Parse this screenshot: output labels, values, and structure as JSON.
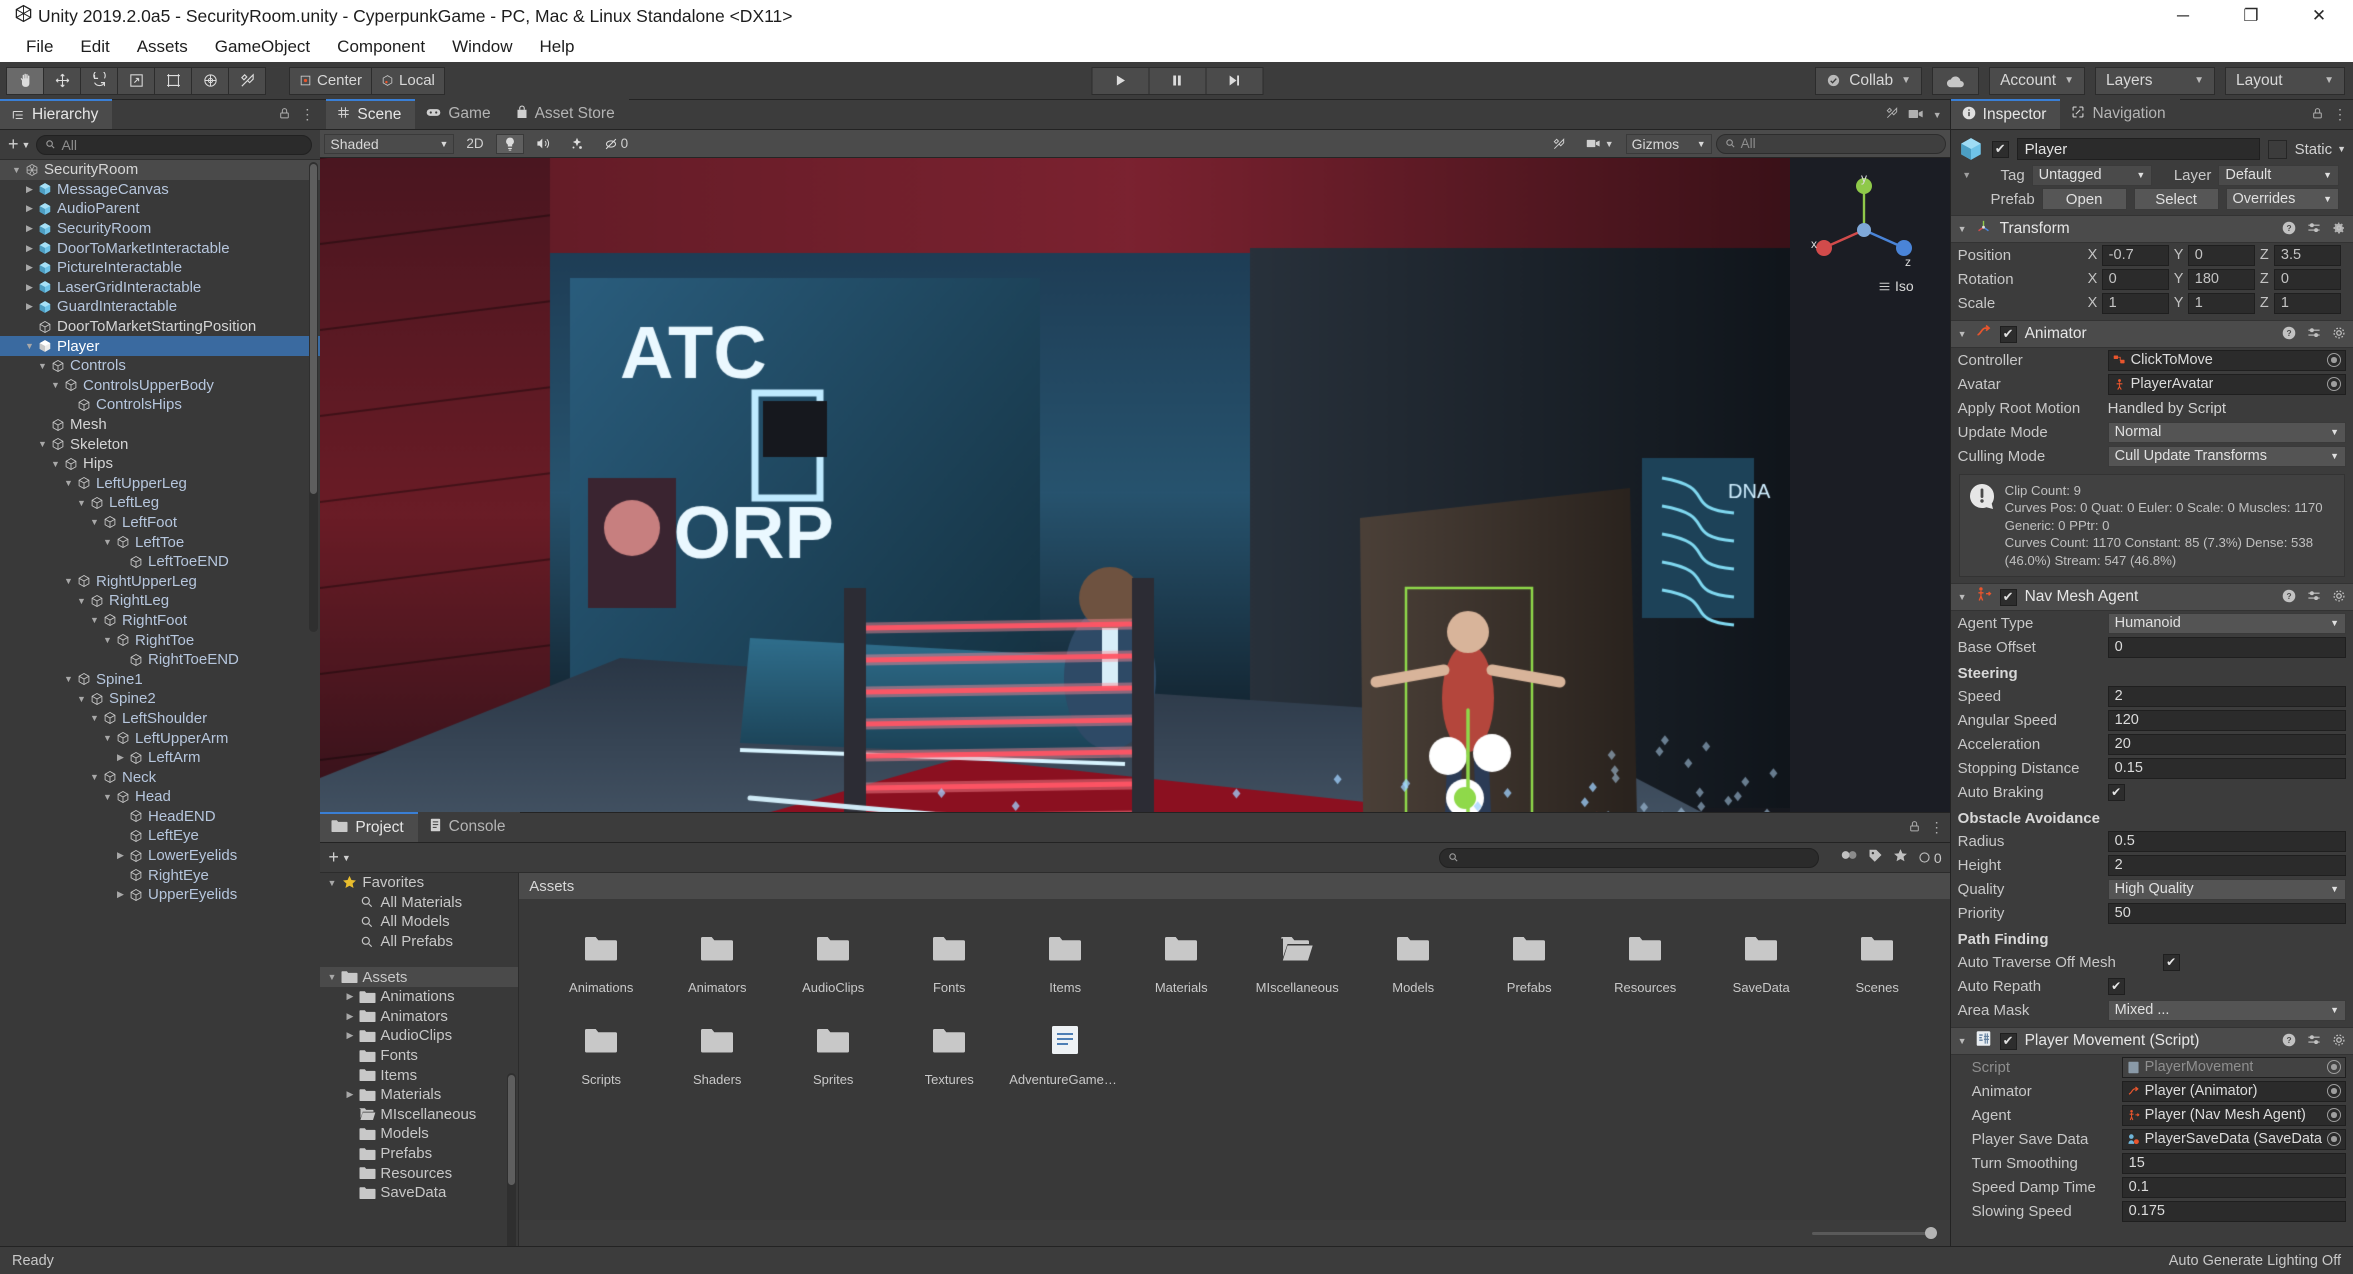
{
  "window": {
    "title": "Unity 2019.2.0a5 - SecurityRoom.unity - CyperpunkGame - PC, Mac & Linux Standalone <DX11>",
    "minimize": "─",
    "maximize": "❐",
    "close": "✕"
  },
  "menu": {
    "items": [
      "File",
      "Edit",
      "Assets",
      "GameObject",
      "Component",
      "Window",
      "Help"
    ]
  },
  "toolbar": {
    "tools": [
      {
        "name": "hand-tool",
        "selected": true
      },
      {
        "name": "move-tool",
        "selected": false
      },
      {
        "name": "rotate-tool",
        "selected": false
      },
      {
        "name": "scale-tool",
        "selected": false
      },
      {
        "name": "rect-tool",
        "selected": false
      },
      {
        "name": "transform-tool",
        "selected": false
      },
      {
        "name": "custom-tool",
        "selected": false
      }
    ],
    "pivot_label": "Center",
    "space_label": "Local",
    "play": "▶",
    "pause": "❚❚",
    "step": "▶|",
    "collab": "Collab",
    "cloud": "cloud-icon",
    "account": "Account",
    "layers": "Layers",
    "layout": "Layout"
  },
  "hierarchy": {
    "tab": "Hierarchy",
    "search_placeholder": "All",
    "create_label": "+",
    "items": [
      {
        "label": "SecurityRoom",
        "depth": 0,
        "arrow": "down",
        "icon": "scene-icon",
        "root": true
      },
      {
        "label": "MessageCanvas",
        "depth": 1,
        "arrow": "right",
        "icon": "prefab-icon",
        "prefab": true
      },
      {
        "label": "AudioParent",
        "depth": 1,
        "arrow": "right",
        "icon": "prefab-icon",
        "prefab": true
      },
      {
        "label": "SecurityRoom",
        "depth": 1,
        "arrow": "right",
        "icon": "prefab-icon",
        "prefab": true
      },
      {
        "label": "DoorToMarketInteractable",
        "depth": 1,
        "arrow": "right",
        "icon": "prefab-icon",
        "prefab": true
      },
      {
        "label": "PictureInteractable",
        "depth": 1,
        "arrow": "right",
        "icon": "prefab-icon",
        "prefab": true
      },
      {
        "label": "LaserGridInteractable",
        "depth": 1,
        "arrow": "right",
        "icon": "prefab-icon",
        "prefab": true
      },
      {
        "label": "GuardInteractable",
        "depth": 1,
        "arrow": "right",
        "icon": "prefab-icon",
        "prefab": true
      },
      {
        "label": "DoorToMarketStartingPosition",
        "depth": 1,
        "arrow": "",
        "icon": "gameobject-icon",
        "white": true
      },
      {
        "label": "Player",
        "depth": 1,
        "arrow": "down",
        "icon": "prefab-white-icon",
        "selected": true
      },
      {
        "label": "Controls",
        "depth": 2,
        "arrow": "down",
        "icon": "gameobject-icon"
      },
      {
        "label": "ControlsUpperBody",
        "depth": 3,
        "arrow": "down",
        "icon": "gameobject-icon"
      },
      {
        "label": "ControlsHips",
        "depth": 4,
        "arrow": "",
        "icon": "gameobject-icon"
      },
      {
        "label": "Mesh",
        "depth": 2,
        "arrow": "",
        "icon": "gameobject-icon",
        "white": true
      },
      {
        "label": "Skeleton",
        "depth": 2,
        "arrow": "down",
        "icon": "gameobject-icon",
        "white": true
      },
      {
        "label": "Hips",
        "depth": 3,
        "arrow": "down",
        "icon": "gameobject-icon",
        "white": true
      },
      {
        "label": "LeftUpperLeg",
        "depth": 4,
        "arrow": "down",
        "icon": "gameobject-icon"
      },
      {
        "label": "LeftLeg",
        "depth": 5,
        "arrow": "down",
        "icon": "gameobject-icon"
      },
      {
        "label": "LeftFoot",
        "depth": 6,
        "arrow": "down",
        "icon": "gameobject-icon"
      },
      {
        "label": "LeftToe",
        "depth": 7,
        "arrow": "down",
        "icon": "gameobject-icon"
      },
      {
        "label": "LeftToeEND",
        "depth": 8,
        "arrow": "",
        "icon": "gameobject-icon"
      },
      {
        "label": "RightUpperLeg",
        "depth": 4,
        "arrow": "down",
        "icon": "gameobject-icon"
      },
      {
        "label": "RightLeg",
        "depth": 5,
        "arrow": "down",
        "icon": "gameobject-icon"
      },
      {
        "label": "RightFoot",
        "depth": 6,
        "arrow": "down",
        "icon": "gameobject-icon"
      },
      {
        "label": "RightToe",
        "depth": 7,
        "arrow": "down",
        "icon": "gameobject-icon"
      },
      {
        "label": "RightToeEND",
        "depth": 8,
        "arrow": "",
        "icon": "gameobject-icon"
      },
      {
        "label": "Spine1",
        "depth": 4,
        "arrow": "down",
        "icon": "gameobject-icon"
      },
      {
        "label": "Spine2",
        "depth": 5,
        "arrow": "down",
        "icon": "gameobject-icon"
      },
      {
        "label": "LeftShoulder",
        "depth": 6,
        "arrow": "down",
        "icon": "gameobject-icon"
      },
      {
        "label": "LeftUpperArm",
        "depth": 7,
        "arrow": "down",
        "icon": "gameobject-icon"
      },
      {
        "label": "LeftArm",
        "depth": 8,
        "arrow": "right",
        "icon": "gameobject-icon"
      },
      {
        "label": "Neck",
        "depth": 6,
        "arrow": "down",
        "icon": "gameobject-icon"
      },
      {
        "label": "Head",
        "depth": 7,
        "arrow": "down",
        "icon": "gameobject-icon"
      },
      {
        "label": "HeadEND",
        "depth": 8,
        "arrow": "",
        "icon": "gameobject-icon"
      },
      {
        "label": "LeftEye",
        "depth": 8,
        "arrow": "",
        "icon": "gameobject-icon"
      },
      {
        "label": "LowerEyelids",
        "depth": 8,
        "arrow": "right",
        "icon": "gameobject-icon"
      },
      {
        "label": "RightEye",
        "depth": 8,
        "arrow": "",
        "icon": "gameobject-icon"
      },
      {
        "label": "UpperEyelids",
        "depth": 8,
        "arrow": "right",
        "icon": "gameobject-icon"
      }
    ]
  },
  "scene": {
    "tabs": [
      {
        "label": "Scene",
        "icon": "scene-grid-icon",
        "active": true
      },
      {
        "label": "Game",
        "icon": "game-icon",
        "active": false
      },
      {
        "label": "Asset Store",
        "icon": "store-icon",
        "active": false
      }
    ],
    "shading": "Shaded",
    "mode_2d": "2D",
    "lighting_icon": "lighting-icon",
    "audio_icon": "audio-icon",
    "fx_icon": "effects-icon",
    "hidden_icon": "hidden-objects-icon",
    "hidden_count": "0",
    "tools_icon": "scene-tools-icon",
    "camera_icon": "scene-camera-icon",
    "gizmos": "Gizmos",
    "search_placeholder": "All",
    "iso_label": "Iso",
    "gizmo_axes": {
      "x": "x",
      "y": "y",
      "z": "z"
    }
  },
  "project": {
    "tabs": [
      {
        "label": "Project",
        "icon": "project-icon",
        "active": true
      },
      {
        "label": "Console",
        "icon": "console-icon",
        "active": false
      }
    ],
    "create_label": "+",
    "search_placeholder": "",
    "breadcrumb": "Assets",
    "tree": [
      {
        "label": "Favorites",
        "depth": 0,
        "arrow": "down",
        "icon": "star-icon"
      },
      {
        "label": "All Materials",
        "depth": 1,
        "arrow": "",
        "icon": "search-icon"
      },
      {
        "label": "All Models",
        "depth": 1,
        "arrow": "",
        "icon": "search-icon"
      },
      {
        "label": "All Prefabs",
        "depth": 1,
        "arrow": "",
        "icon": "search-icon"
      },
      {
        "label": "",
        "depth": 0,
        "arrow": "",
        "icon": "spacer"
      },
      {
        "label": "Assets",
        "depth": 0,
        "arrow": "down",
        "icon": "folder-icon",
        "selected": true
      },
      {
        "label": "Animations",
        "depth": 1,
        "arrow": "right",
        "icon": "folder-icon"
      },
      {
        "label": "Animators",
        "depth": 1,
        "arrow": "right",
        "icon": "folder-icon"
      },
      {
        "label": "AudioClips",
        "depth": 1,
        "arrow": "right",
        "icon": "folder-icon"
      },
      {
        "label": "Fonts",
        "depth": 1,
        "arrow": "",
        "icon": "folder-icon"
      },
      {
        "label": "Items",
        "depth": 1,
        "arrow": "",
        "icon": "folder-icon"
      },
      {
        "label": "Materials",
        "depth": 1,
        "arrow": "right",
        "icon": "folder-icon"
      },
      {
        "label": "MIscellaneous",
        "depth": 1,
        "arrow": "",
        "icon": "folder-open-icon"
      },
      {
        "label": "Models",
        "depth": 1,
        "arrow": "",
        "icon": "folder-icon"
      },
      {
        "label": "Prefabs",
        "depth": 1,
        "arrow": "",
        "icon": "folder-icon"
      },
      {
        "label": "Resources",
        "depth": 1,
        "arrow": "",
        "icon": "folder-icon"
      },
      {
        "label": "SaveData",
        "depth": 1,
        "arrow": "",
        "icon": "folder-icon"
      }
    ],
    "assets": [
      {
        "label": "Animations",
        "icon": "folder-icon"
      },
      {
        "label": "Animators",
        "icon": "folder-icon"
      },
      {
        "label": "AudioClips",
        "icon": "folder-icon"
      },
      {
        "label": "Fonts",
        "icon": "folder-icon"
      },
      {
        "label": "Items",
        "icon": "folder-icon"
      },
      {
        "label": "Materials",
        "icon": "folder-icon"
      },
      {
        "label": "MIscellaneous",
        "icon": "folder-open-icon"
      },
      {
        "label": "Models",
        "icon": "folder-icon"
      },
      {
        "label": "Prefabs",
        "icon": "folder-icon"
      },
      {
        "label": "Resources",
        "icon": "folder-icon"
      },
      {
        "label": "SaveData",
        "icon": "folder-icon"
      },
      {
        "label": "Scenes",
        "icon": "folder-icon"
      },
      {
        "label": "Scripts",
        "icon": "folder-icon"
      },
      {
        "label": "Shaders",
        "icon": "folder-icon"
      },
      {
        "label": "Sprites",
        "icon": "folder-icon"
      },
      {
        "label": "Textures",
        "icon": "folder-icon"
      },
      {
        "label": "AdventureGameS...",
        "icon": "text-asset-icon"
      }
    ]
  },
  "inspector": {
    "tabs": [
      {
        "label": "Inspector",
        "icon": "info-icon",
        "active": true
      },
      {
        "label": "Navigation",
        "icon": "navigation-icon",
        "active": false
      }
    ],
    "object_name": "Player",
    "static_label": "Static",
    "tag_label": "Tag",
    "tag_value": "Untagged",
    "layer_label": "Layer",
    "layer_value": "Default",
    "prefab_label": "Prefab",
    "prefab_open": "Open",
    "prefab_select": "Select",
    "prefab_overrides": "Overrides",
    "transform": {
      "title": "Transform",
      "rows": [
        {
          "label": "Position",
          "x": "-0.7",
          "y": "0",
          "z": "3.5"
        },
        {
          "label": "Rotation",
          "x": "0",
          "y": "180",
          "z": "0"
        },
        {
          "label": "Scale",
          "x": "1",
          "y": "1",
          "z": "1"
        }
      ]
    },
    "animator": {
      "title": "Animator",
      "controller_label": "Controller",
      "controller_value": "ClickToMove",
      "avatar_label": "Avatar",
      "avatar_value": "PlayerAvatar",
      "root_motion_label": "Apply Root Motion",
      "root_motion_value": "Handled by Script",
      "update_mode_label": "Update Mode",
      "update_mode_value": "Normal",
      "culling_mode_label": "Culling Mode",
      "culling_mode_value": "Cull Update Transforms",
      "info": "Clip Count: 9\nCurves Pos: 0 Quat: 0 Euler: 0 Scale: 0 Muscles: 1170\nGeneric: 0 PPtr: 0\nCurves Count: 1170 Constant: 85 (7.3%) Dense: 538 (46.0%) Stream: 547 (46.8%)"
    },
    "navmesh": {
      "title": "Nav Mesh Agent",
      "agent_type_label": "Agent Type",
      "agent_type_value": "Humanoid",
      "base_offset_label": "Base Offset",
      "base_offset_value": "0",
      "steering_header": "Steering",
      "speed_label": "Speed",
      "speed_value": "2",
      "angular_label": "Angular Speed",
      "angular_value": "120",
      "accel_label": "Acceleration",
      "accel_value": "20",
      "stopping_label": "Stopping Distance",
      "stopping_value": "0.15",
      "braking_label": "Auto Braking",
      "braking_checked": true,
      "obstacle_header": "Obstacle Avoidance",
      "radius_label": "Radius",
      "radius_value": "0.5",
      "height_label": "Height",
      "height_value": "2",
      "quality_label": "Quality",
      "quality_value": "High Quality",
      "priority_label": "Priority",
      "priority_value": "50",
      "path_header": "Path Finding",
      "traverse_label": "Auto Traverse Off Mesh",
      "traverse_checked": true,
      "repath_label": "Auto Repath",
      "repath_checked": true,
      "area_label": "Area Mask",
      "area_value": "Mixed ..."
    },
    "player_movement": {
      "title": "Player Movement (Script)",
      "script_label": "Script",
      "script_value": "PlayerMovement",
      "animator_label": "Animator",
      "animator_value": "Player (Animator)",
      "agent_label": "Agent",
      "agent_value": "Player (Nav Mesh Agent)",
      "save_label": "Player Save Data",
      "save_value": "PlayerSaveData (SaveData",
      "turn_label": "Turn Smoothing",
      "turn_value": "15",
      "damp_label": "Speed Damp Time",
      "damp_value": "0.1",
      "slow_label": "Slowing Speed",
      "slow_value": "0.175"
    }
  },
  "status": {
    "left": "Ready",
    "right": "Auto Generate Lighting Off"
  },
  "colors": {
    "accent": "#3a6aa0",
    "panel": "#3c3c3c",
    "panel_dark": "#393939",
    "prefab_blue": "#7da6d9",
    "unity_orange": "#e8552d"
  }
}
